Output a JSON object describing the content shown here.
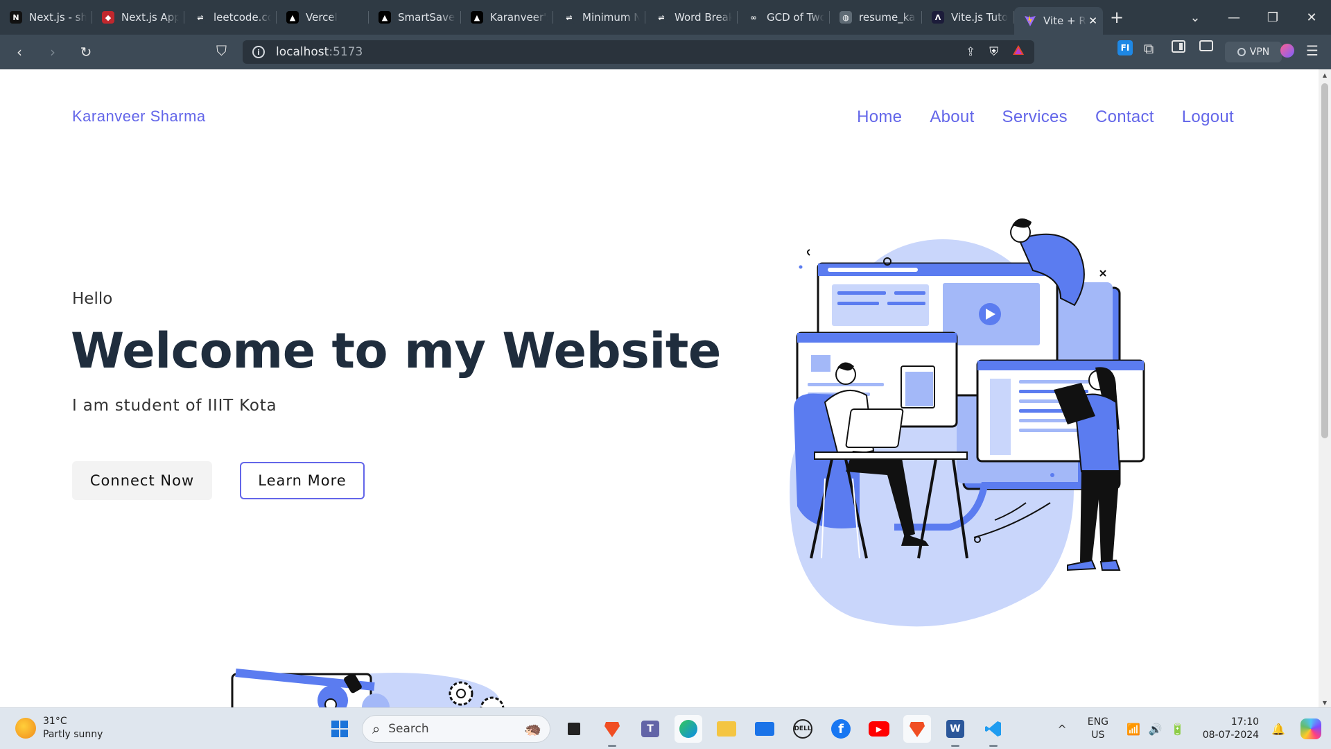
{
  "browser": {
    "tabs": [
      {
        "label": "Next.js - sh",
        "icon": "nextjs-icon",
        "icon_bg": "#111111",
        "icon_glyph": "N"
      },
      {
        "label": "Next.js App",
        "icon": "redirect-icon",
        "icon_bg": "#c1272d",
        "icon_glyph": "◆"
      },
      {
        "label": "leetcode.co",
        "icon": "leetcode-icon",
        "icon_bg": "#2f3a44",
        "icon_glyph": "⇌"
      },
      {
        "label": "Vercel",
        "icon": "vercel-icon",
        "icon_bg": "#000000",
        "icon_glyph": "▲"
      },
      {
        "label": "SmartSaver",
        "icon": "vercel-icon",
        "icon_bg": "#000000",
        "icon_glyph": "▲"
      },
      {
        "label": "Karanveer's",
        "icon": "vercel-icon",
        "icon_bg": "#000000",
        "icon_glyph": "▲"
      },
      {
        "label": "Minimum N",
        "icon": "leetcode-icon",
        "icon_bg": "#2f3a44",
        "icon_glyph": "⇌"
      },
      {
        "label": "Word Break",
        "icon": "leetcode-icon",
        "icon_bg": "#2f3a44",
        "icon_glyph": "⇌"
      },
      {
        "label": "GCD of Two",
        "icon": "gfg-icon",
        "icon_bg": "#2f3a44",
        "icon_glyph": "∞"
      },
      {
        "label": "resume_kar",
        "icon": "globe-icon",
        "icon_bg": "#5f6b75",
        "icon_glyph": "◍"
      },
      {
        "label": "Vite.js Tuto",
        "icon": "vitejs-icon",
        "icon_bg": "#1c1c3a",
        "icon_glyph": "Λ"
      }
    ],
    "active_tab": {
      "label": "Vite + R",
      "icon": "vite-icon",
      "close_glyph": "✕"
    },
    "new_tab_glyph": "+",
    "window_controls": {
      "dropdown": "⌄",
      "minimize": "—",
      "restore": "❐",
      "close": "✕"
    },
    "nav": {
      "back": "‹",
      "forward": "›",
      "reload": "↻",
      "bookmark": "⛉"
    },
    "url": {
      "host": "localhost",
      "port": ":5173"
    },
    "extensions": {
      "vpn_label": "VPN",
      "fi_label": "FI"
    }
  },
  "site": {
    "brand": "Karanveer Sharma",
    "nav": [
      "Home",
      "About",
      "Services",
      "Contact",
      "Logout"
    ],
    "hero": {
      "greeting": "Hello",
      "title": "Welcome to my Website",
      "subtitle": "I am student of IIIT Kota",
      "primary_button": "Connect Now",
      "secondary_button": "Learn More"
    },
    "colors": {
      "accent": "#6366e9",
      "illustration_blue": "#5b7cf0",
      "illustration_light": "#c9d6fb",
      "heading": "#1f2d3d"
    }
  },
  "taskbar": {
    "weather": {
      "temp": "31°C",
      "condition": "Partly sunny"
    },
    "search_placeholder": "Search",
    "apps": [
      "windows-start",
      "search",
      "task-view",
      "brave",
      "teams",
      "edge",
      "file-explorer",
      "mail",
      "dell",
      "facebook",
      "youtube",
      "brave-active",
      "word",
      "vscode"
    ],
    "tray": {
      "lang_top": "ENG",
      "lang_bottom": "US",
      "time": "17:10",
      "date": "08-07-2024"
    }
  }
}
